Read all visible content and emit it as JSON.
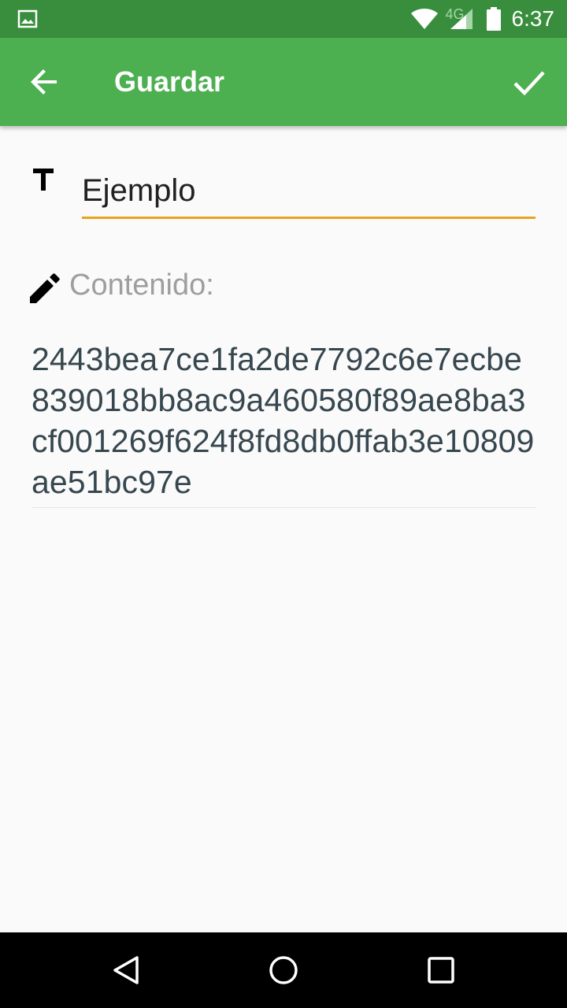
{
  "status_bar": {
    "network_label": "4G",
    "time": "6:37"
  },
  "app_bar": {
    "title": "Guardar"
  },
  "form": {
    "title_value": "Ejemplo",
    "content_label": "Contenido:",
    "content_value": "2443bea7ce1fa2de7792c6e7ecbe839018bb8ac9a460580f89ae8ba3cf001269f624f8fd8db0ffab3e10809ae51bc97e"
  },
  "colors": {
    "status_bar": "#388e3c",
    "app_bar": "#4caf50",
    "accent_underline": "#e8a31c",
    "background": "#fafafa"
  },
  "icons": {
    "status_left": "image-icon",
    "wifi": "wifi-icon",
    "signal": "signal-icon",
    "battery": "battery-icon",
    "back": "arrow-back-icon",
    "confirm": "check-icon",
    "title_field": "text-t-icon",
    "content_field": "pencil-icon",
    "nav_back": "nav-back-triangle-icon",
    "nav_home": "nav-home-circle-icon",
    "nav_recents": "nav-recents-square-icon"
  }
}
